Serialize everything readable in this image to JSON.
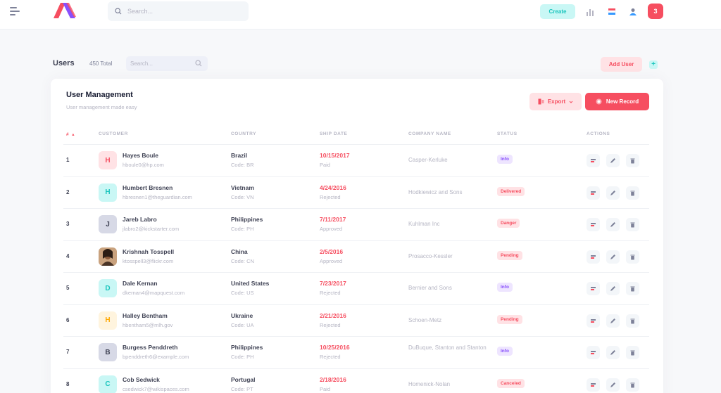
{
  "header": {
    "search_placeholder": "Search...",
    "create_label": "Create",
    "user_initial": "3"
  },
  "subheader": {
    "title": "Users",
    "total": "450 Total",
    "search_placeholder": "Search...",
    "add_user_label": "Add User",
    "plus_label": "+"
  },
  "card": {
    "title": "User Management",
    "subtitle": "User management made easy",
    "export_label": "Export",
    "new_record_label": "New Record"
  },
  "columns": {
    "hash": "#",
    "customer": "Customer",
    "country": "Country",
    "ship_date": "Ship Date",
    "company": "Company Name",
    "status": "Status",
    "actions": "Actions"
  },
  "colors": {
    "accent": "#f64e60",
    "accent_light": "#ffe2e5",
    "teal": "#1bc5bd",
    "teal_light": "#c9f7f5",
    "purple": "#8950fc",
    "purple_light": "#eee5ff"
  },
  "rows": [
    {
      "index": "1",
      "initial": "H",
      "avatar_style": "red",
      "name": "Hayes Boule",
      "email": "hboule0@hp.com",
      "country": "Brazil",
      "code": "Code: BR",
      "date": "10/15/2017",
      "date_status": "Paid",
      "company": "Casper-Kerluke",
      "status": "Info",
      "status_style": "info"
    },
    {
      "index": "2",
      "initial": "H",
      "avatar_style": "teal",
      "name": "Humbert Bresnen",
      "email": "hbresnen1@theguardian.com",
      "country": "Vietnam",
      "code": "Code: VN",
      "date": "4/24/2016",
      "date_status": "Rejected",
      "company": "Hodkiewicz and Sons",
      "status": "Delivered",
      "status_style": "delivered"
    },
    {
      "index": "3",
      "initial": "J",
      "avatar_style": "dark",
      "name": "Jareb Labro",
      "email": "jlabro2@kickstarter.com",
      "country": "Philippines",
      "code": "Code: PH",
      "date": "7/11/2017",
      "date_status": "Approved",
      "company": "Kuhlman Inc",
      "status": "Danger",
      "status_style": "danger"
    },
    {
      "index": "4",
      "initial": "",
      "avatar_style": "photo",
      "name": "Krishnah Tosspell",
      "email": "ktosspell3@flickr.com",
      "country": "China",
      "code": "Code: CN",
      "date": "2/5/2016",
      "date_status": "Approved",
      "company": "Prosacco-Kessler",
      "status": "Pending",
      "status_style": "pending"
    },
    {
      "index": "5",
      "initial": "D",
      "avatar_style": "teal",
      "name": "Dale Kernan",
      "email": "dkernan4@mapquest.com",
      "country": "United States",
      "code": "Code: US",
      "date": "7/23/2017",
      "date_status": "Rejected",
      "company": "Bernier and Sons",
      "status": "Info",
      "status_style": "info"
    },
    {
      "index": "6",
      "initial": "H",
      "avatar_style": "orange",
      "name": "Halley Bentham",
      "email": "hbentham5@mlh.gov",
      "country": "Ukraine",
      "code": "Code: UA",
      "date": "2/21/2016",
      "date_status": "Rejected",
      "company": "Schoen-Metz",
      "status": "Pending",
      "status_style": "pending"
    },
    {
      "index": "7",
      "initial": "B",
      "avatar_style": "dark",
      "name": "Burgess Penddreth",
      "email": "bpenddreth6@example.com",
      "country": "Philippines",
      "code": "Code: PH",
      "date": "10/25/2016",
      "date_status": "Rejected",
      "company": "DuBuque, Stanton and Stanton",
      "status": "Info",
      "status_style": "info"
    },
    {
      "index": "8",
      "initial": "C",
      "avatar_style": "teal",
      "name": "Cob Sedwick",
      "email": "csedwick7@wikispaces.com",
      "country": "Portugal",
      "code": "Code: PT",
      "date": "2/18/2016",
      "date_status": "Paid",
      "company": "Homenick-Nolan",
      "status": "Canceled",
      "status_style": "canceled"
    }
  ]
}
